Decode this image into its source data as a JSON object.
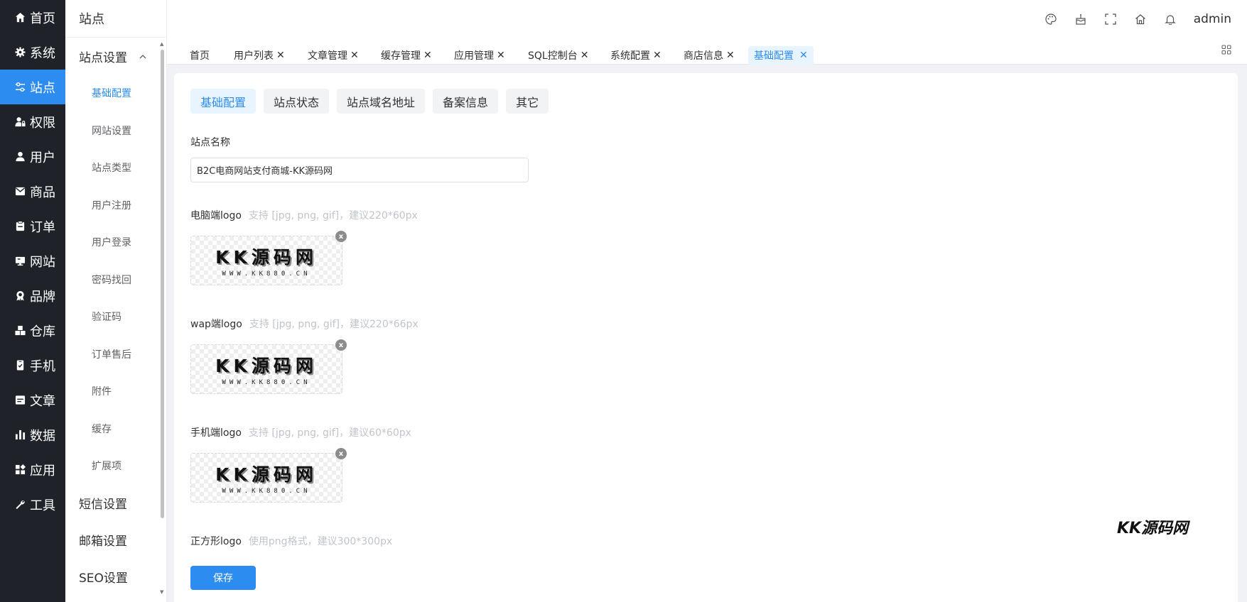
{
  "nav": {
    "items": [
      {
        "label": "首页",
        "icon": "home-icon"
      },
      {
        "label": "系统",
        "icon": "gear-icon"
      },
      {
        "label": "站点",
        "icon": "sliders-icon",
        "active": true
      },
      {
        "label": "权限",
        "icon": "user-lock-icon"
      },
      {
        "label": "用户",
        "icon": "user-icon"
      },
      {
        "label": "商品",
        "icon": "mail-box-icon"
      },
      {
        "label": "订单",
        "icon": "clipboard-icon"
      },
      {
        "label": "网站",
        "icon": "monitor-icon"
      },
      {
        "label": "品牌",
        "icon": "award-icon"
      },
      {
        "label": "仓库",
        "icon": "boxes-icon"
      },
      {
        "label": "手机",
        "icon": "phone-icon"
      },
      {
        "label": "文章",
        "icon": "document-icon"
      },
      {
        "label": "数据",
        "icon": "bar-chart-icon"
      },
      {
        "label": "应用",
        "icon": "grid-icon"
      },
      {
        "label": "工具",
        "icon": "wrench-icon"
      }
    ]
  },
  "submenu": {
    "title": "站点",
    "group": "站点设置",
    "items": [
      "基础配置",
      "网站设置",
      "站点类型",
      "用户注册",
      "用户登录",
      "密码找回",
      "验证码",
      "订单售后",
      "附件",
      "缓存",
      "扩展项"
    ],
    "other_groups": [
      "短信设置",
      "邮箱设置",
      "SEO设置"
    ]
  },
  "header": {
    "user": "admin",
    "icons": [
      "palette-icon",
      "cake-icon",
      "fullscreen-icon",
      "home-icon",
      "bell-icon"
    ]
  },
  "tabs": [
    {
      "label": "首页",
      "closable": false
    },
    {
      "label": "用户列表",
      "closable": true
    },
    {
      "label": "文章管理",
      "closable": true
    },
    {
      "label": "缓存管理",
      "closable": true
    },
    {
      "label": "应用管理",
      "closable": true
    },
    {
      "label": "SQL控制台",
      "closable": true
    },
    {
      "label": "系统配置",
      "closable": true
    },
    {
      "label": "商店信息",
      "closable": true
    },
    {
      "label": "基础配置",
      "closable": true,
      "active": true
    }
  ],
  "form": {
    "subtabs": [
      "基础配置",
      "站点状态",
      "站点域名地址",
      "备案信息",
      "其它"
    ],
    "site_name_label": "站点名称",
    "site_name_value": "B2C电商网站支付商城-KK源码网",
    "pc_logo_label": "电脑端logo",
    "pc_logo_hint": "支持 [jpg, png, gif]，建议220*60px",
    "wap_logo_label": "wap端logo",
    "wap_logo_hint": "支持 [jpg, png, gif]，建议220*66px",
    "mobile_logo_label": "手机端logo",
    "mobile_logo_hint": "支持 [jpg, png, gif]，建议60*60px",
    "square_logo_label": "正方形logo",
    "square_logo_hint": "使用png格式，建议300*300px",
    "logo_text_main": "KK源码网",
    "logo_text_sub": "WWW.KK880.CN",
    "remove_glyph": "x",
    "save_label": "保存"
  },
  "watermark": "KK源码网",
  "colors": {
    "primary": "#2d8cf0",
    "nav_bg": "#1f2329"
  }
}
